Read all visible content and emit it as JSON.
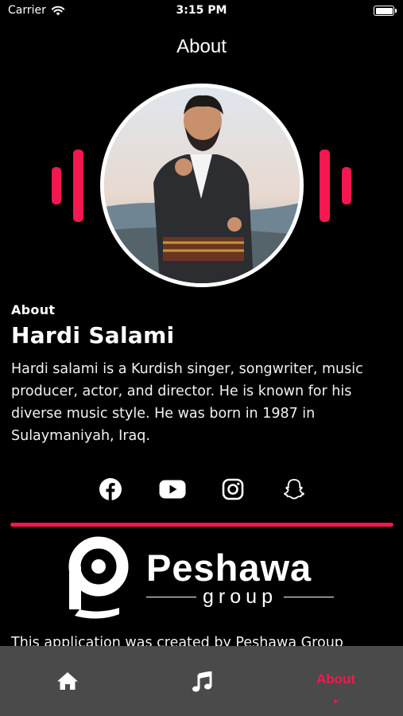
{
  "status_bar": {
    "carrier": "Carrier",
    "time": "3:15 PM"
  },
  "nav": {
    "title": "About"
  },
  "about": {
    "label": "About",
    "name": "Hardi Salami",
    "bio": "Hardi salami is a Kurdish singer, songwriter, music producer, actor, and director. He is known for his diverse music style. He was born in 1987 in Sulaymaniyah, Iraq."
  },
  "social": [
    {
      "icon": "facebook-icon"
    },
    {
      "icon": "youtube-icon"
    },
    {
      "icon": "instagram-icon"
    },
    {
      "icon": "snapchat-icon"
    }
  ],
  "logo": {
    "wordmark": "Peshawa",
    "subtitle": "group"
  },
  "footer": {
    "credit": "This application was created by Peshawa Group"
  },
  "tab_bar": {
    "tabs": [
      {
        "icon": "home-icon",
        "label": ""
      },
      {
        "icon": "music-note-icon",
        "label": ""
      },
      {
        "icon": "",
        "label": "About"
      }
    ],
    "active_index": 2
  },
  "colors": {
    "accent": "#f5174f",
    "background": "#000000",
    "tab_bar": "#4a4a4a",
    "text": "#ffffff"
  }
}
